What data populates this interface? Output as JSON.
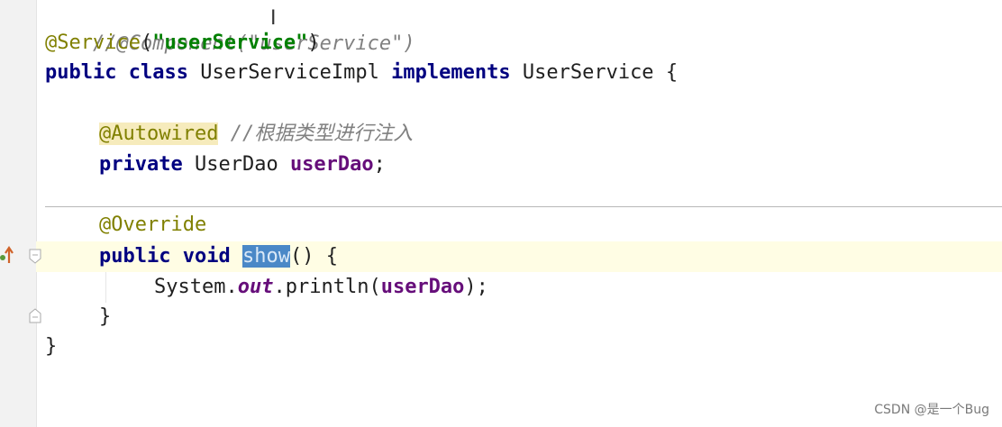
{
  "editor": {
    "line1": {
      "comment": "//@Component(\"userService\")"
    },
    "line2": {
      "annotation": "@Service",
      "open": "(",
      "string": "\"userService\"",
      "close": ")"
    },
    "line3": {
      "kw1": "public",
      "kw2": "class",
      "class_name": "UserServiceImpl",
      "kw3": "implements",
      "interface_name": "UserService",
      "brace": "{"
    },
    "line5": {
      "annotation": "@Autowired",
      "comment": "//根据类型进行注入"
    },
    "line6": {
      "kw": "private",
      "type": "UserDao",
      "field": "userDao",
      "semicolon": ";"
    },
    "line8": {
      "annotation": "@Override"
    },
    "line9": {
      "kw1": "public",
      "kw2": "void",
      "method": "show",
      "rest": "() {"
    },
    "line10": {
      "cls": "System",
      "dot1": ".",
      "static_field": "out",
      "dot2": ".println(",
      "arg": "userDao",
      "end": ");"
    },
    "line11": {
      "brace": "}"
    },
    "line12": {
      "brace": "}"
    }
  },
  "gutter_icons": [
    "implementation-marker-icon",
    "fold-start-icon",
    "fold-end-icon"
  ],
  "watermark": "CSDN @是一个Bug"
}
